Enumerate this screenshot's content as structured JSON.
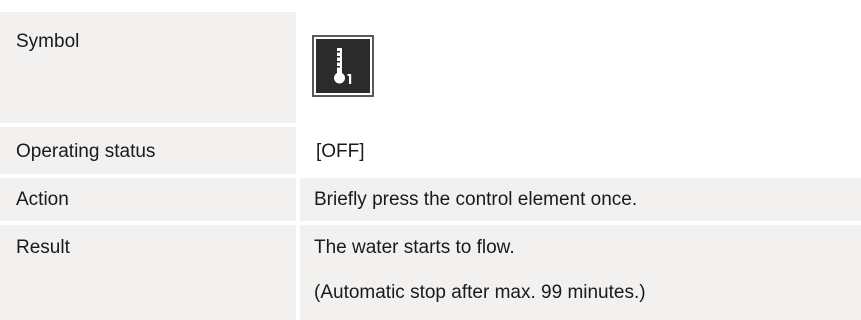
{
  "rows": {
    "symbol": {
      "label": "Symbol",
      "icon": "thermometer-1-icon"
    },
    "operating_status": {
      "label": "Operating status",
      "value": "[OFF]"
    },
    "action": {
      "label": "Action",
      "value": "Briefly press the control element once."
    },
    "result": {
      "label": "Result",
      "value_line1": "The water starts to flow.",
      "value_line2": "(Automatic stop after max. 99 minutes.)"
    }
  },
  "colors": {
    "cell_background": "#f2f1f0",
    "icon_background": "#2b2b2b",
    "text": "#1a1a1a"
  }
}
